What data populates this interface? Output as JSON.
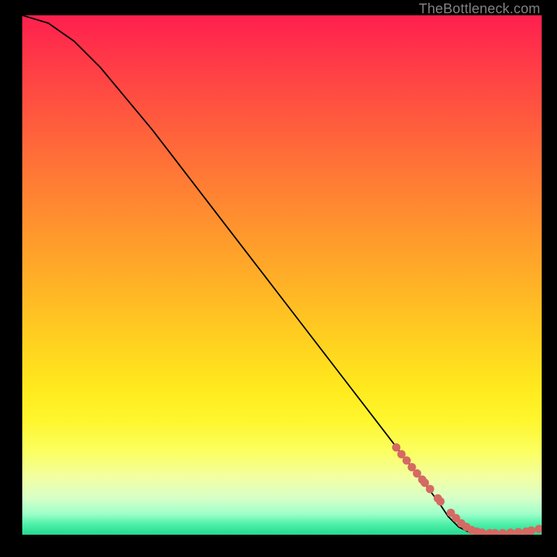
{
  "watermark": "TheBottleneck.com",
  "chart_data": {
    "type": "line",
    "title": "",
    "xlabel": "",
    "ylabel": "",
    "xlim": [
      0,
      100
    ],
    "ylim": [
      0,
      100
    ],
    "series": [
      {
        "name": "curve",
        "x": [
          0,
          5,
          10,
          15,
          20,
          25,
          30,
          35,
          40,
          45,
          50,
          55,
          60,
          65,
          70,
          75,
          80,
          82,
          84,
          86,
          88,
          90,
          92,
          94,
          96,
          98,
          100
        ],
        "y": [
          100,
          98.5,
          95,
          90,
          84,
          78,
          71.5,
          65,
          58.5,
          52,
          45.5,
          39,
          32.5,
          26,
          19.5,
          13,
          6.5,
          3.5,
          1.5,
          0.5,
          0.2,
          0.2,
          0.2,
          0.3,
          0.4,
          0.6,
          1.2
        ]
      },
      {
        "name": "dots",
        "x": [
          72,
          73,
          74,
          75,
          76,
          77,
          77.5,
          78.5,
          80,
          80.5,
          82.5,
          83.5,
          84.5,
          85.5,
          86.5,
          87.5,
          88.5,
          90,
          91,
          92.5,
          94,
          95.5,
          97,
          98,
          99.5
        ],
        "y": [
          16.8,
          15.5,
          14.3,
          13.0,
          11.8,
          10.6,
          10.0,
          8.8,
          7.0,
          6.4,
          4.2,
          3.2,
          2.2,
          1.5,
          0.9,
          0.6,
          0.4,
          0.3,
          0.3,
          0.3,
          0.4,
          0.5,
          0.6,
          0.8,
          1.1
        ]
      }
    ],
    "colors": {
      "curve_stroke": "#000000",
      "dot_fill": "#d46a63"
    }
  }
}
